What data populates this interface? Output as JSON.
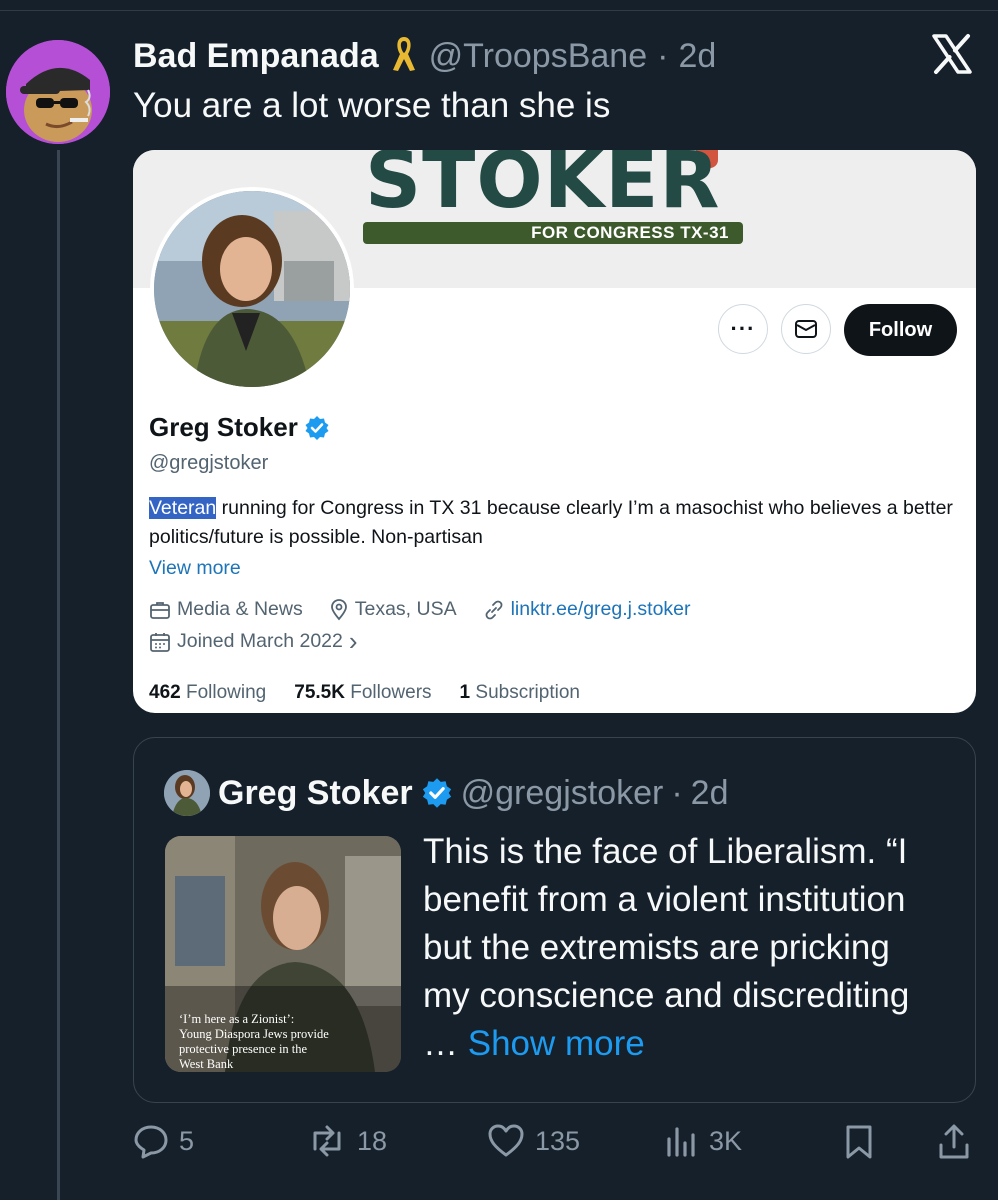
{
  "tweet": {
    "author_name": "Bad Empanada",
    "author_handle": "@TroopsBane",
    "separator": "·",
    "time": "2d",
    "text": "You are a lot worse than she is",
    "badge_icon": "yellow-ribbon-icon",
    "platform_icon": "x-logo-icon"
  },
  "profile_card": {
    "banner_title": "STOKER",
    "banner_subtitle": "FOR CONGRESS TX-31",
    "more_label": "···",
    "follow_label": "Follow",
    "name": "Greg Stoker",
    "handle": "@gregjstoker",
    "bio_highlight": "Veteran",
    "bio_rest": " running for Congress in TX 31 because clearly I’m a masochist who believes a better politics/future is possible. Non-partisan",
    "view_more": "View more",
    "category": "Media & News",
    "location": "Texas, USA",
    "link": "linktr.ee/greg.j.stoker",
    "joined": "Joined March 2022",
    "joined_chevron": "›",
    "following_count": "462",
    "following_label": "Following",
    "followers_count": "75.5K",
    "followers_label": "Followers",
    "subscription_count": "1",
    "subscription_label": "Subscription"
  },
  "quote": {
    "name": "Greg Stoker",
    "handle": "@gregjstoker",
    "separator": "·",
    "time": "2d",
    "image_caption_lines": [
      "‘I’m here as a Zionist’:",
      "Young Diaspora Jews provide",
      "protective presence in the",
      "West Bank"
    ],
    "text": "This is the face of Liberalism. “I benefit from a violent institution but the extremists are pricking my conscience and discrediting … ",
    "show_more": "Show more"
  },
  "actions": {
    "replies": "5",
    "reposts": "18",
    "likes": "135",
    "views": "3K"
  },
  "colors": {
    "background": "#15202b",
    "accent": "#1d9bf0",
    "verified": "#1d9bf0"
  }
}
